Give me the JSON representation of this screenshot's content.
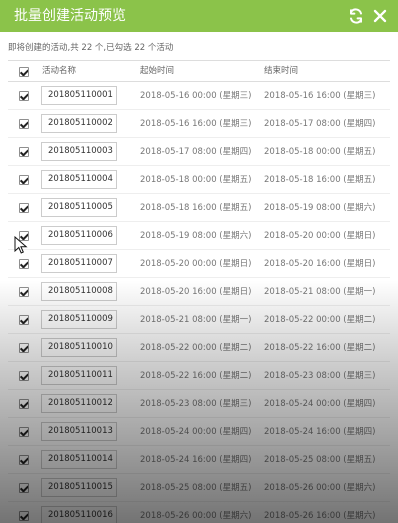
{
  "window": {
    "title": "批量创建活动预览",
    "refresh_icon": "refresh-icon",
    "close_icon": "close-icon"
  },
  "summary": "即将创建的活动,共 22 个,已勾选 22 个活动",
  "table": {
    "headers": {
      "name": "活动名称",
      "start": "起始时间",
      "end": "结束时间"
    },
    "rows": [
      {
        "name": "201805110001",
        "start": "2018-05-16 00:00 (星期三)",
        "end": "2018-05-16 16:00 (星期三)"
      },
      {
        "name": "201805110002",
        "start": "2018-05-16 16:00 (星期三)",
        "end": "2018-05-17 08:00 (星期四)"
      },
      {
        "name": "201805110003",
        "start": "2018-05-17 08:00 (星期四)",
        "end": "2018-05-18 00:00 (星期五)"
      },
      {
        "name": "201805110004",
        "start": "2018-05-18 00:00 (星期五)",
        "end": "2018-05-18 16:00 (星期五)"
      },
      {
        "name": "201805110005",
        "start": "2018-05-18 16:00 (星期五)",
        "end": "2018-05-19 08:00 (星期六)"
      },
      {
        "name": "201805110006",
        "start": "2018-05-19 08:00 (星期六)",
        "end": "2018-05-20 00:00 (星期日)"
      },
      {
        "name": "201805110007",
        "start": "2018-05-20 00:00 (星期日)",
        "end": "2018-05-20 16:00 (星期日)"
      },
      {
        "name": "201805110008",
        "start": "2018-05-20 16:00 (星期日)",
        "end": "2018-05-21 08:00 (星期一)"
      },
      {
        "name": "201805110009",
        "start": "2018-05-21 08:00 (星期一)",
        "end": "2018-05-22 00:00 (星期二)"
      },
      {
        "name": "201805110010",
        "start": "2018-05-22 00:00 (星期二)",
        "end": "2018-05-22 16:00 (星期二)"
      },
      {
        "name": "201805110011",
        "start": "2018-05-22 16:00 (星期二)",
        "end": "2018-05-23 08:00 (星期三)"
      },
      {
        "name": "201805110012",
        "start": "2018-05-23 08:00 (星期三)",
        "end": "2018-05-24 00:00 (星期四)"
      },
      {
        "name": "201805110013",
        "start": "2018-05-24 00:00 (星期四)",
        "end": "2018-05-24 16:00 (星期四)"
      },
      {
        "name": "201805110014",
        "start": "2018-05-24 16:00 (星期四)",
        "end": "2018-05-25 08:00 (星期五)"
      },
      {
        "name": "201805110015",
        "start": "2018-05-25 08:00 (星期五)",
        "end": "2018-05-26 00:00 (星期六)"
      },
      {
        "name": "201805110016",
        "start": "2018-05-26 00:00 (星期六)",
        "end": "2018-05-26 16:00 (星期六)"
      }
    ]
  },
  "colors": {
    "title_bar": "#8bc34a",
    "title_text": "#ffffff",
    "border": "#dddddd"
  }
}
